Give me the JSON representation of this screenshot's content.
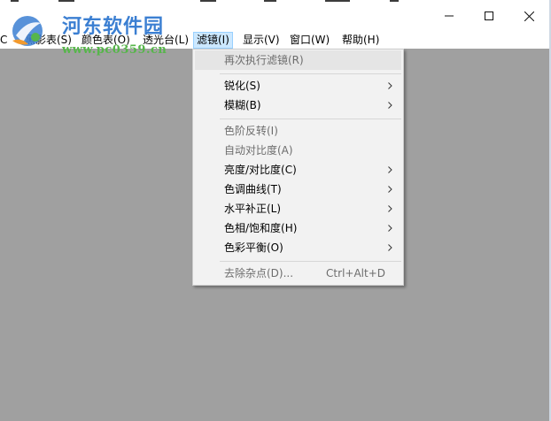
{
  "titlebar": {
    "minimize_icon": "minimize-icon",
    "maximize_icon": "maximize-icon",
    "close_icon": "close-icon"
  },
  "watermark": {
    "title": "河东软件园",
    "url": "www.pc0359.cn",
    "colors": {
      "title": "#3b7fd2",
      "url": "#56b64a"
    }
  },
  "menubar": {
    "items": [
      {
        "label": "C"
      },
      {
        "label": "黑影表(S)"
      },
      {
        "label": "颜色表(O)"
      },
      {
        "label": "透光台(L)"
      },
      {
        "label": "滤镜(I)",
        "active": true
      },
      {
        "label": "显示(V)"
      },
      {
        "label": "窗口(W)"
      },
      {
        "label": "帮助(H)"
      }
    ]
  },
  "filter_menu": {
    "items": [
      {
        "label": "再次执行滤镜(R)",
        "disabled": true
      },
      {
        "label": "锐化(S)",
        "submenu": true
      },
      {
        "label": "模糊(B)",
        "submenu": true
      },
      {
        "label": "色阶反转(I)",
        "disabled": true
      },
      {
        "label": "自动对比度(A)",
        "disabled": true
      },
      {
        "label": "亮度/对比度(C)",
        "submenu": true
      },
      {
        "label": "色调曲线(T)",
        "submenu": true
      },
      {
        "label": "水平补正(L)",
        "submenu": true
      },
      {
        "label": "色相/饱和度(H)",
        "submenu": true
      },
      {
        "label": "色彩平衡(O)",
        "submenu": true
      },
      {
        "label": "去除杂点(D)...",
        "shortcut": "Ctrl+Alt+D",
        "disabled": true
      }
    ],
    "submenu_icon": "chevron-right-icon"
  },
  "colors": {
    "client_background": "#a0a0a0",
    "menu_background": "#f2f2f2",
    "active_menu_highlight": "#cce8ff",
    "disabled_text": "#6d6d6d"
  }
}
